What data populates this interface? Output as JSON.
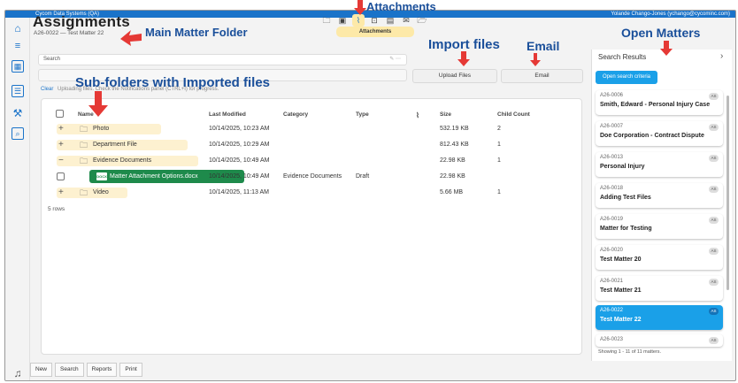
{
  "topbar": {
    "left": "Cycom Data Systems (QA)",
    "right": "Yolande Chango-Jones (ychango@cycominc.com)"
  },
  "header": {
    "title": "Assignments",
    "subtitle": "A26-0022 — Test Matter 22"
  },
  "toolbar": {
    "attachments_tab": "Attachments"
  },
  "search": {
    "placeholder": "Search"
  },
  "actions": {
    "upload": "Upload Files",
    "email": "Email"
  },
  "status": {
    "clear": "Clear",
    "message": "Uploading files. Check the Notifications panel (CTRL+I) for progress."
  },
  "table": {
    "headers": {
      "name": "Name",
      "modified": "Last Modified",
      "category": "Category",
      "type": "Type",
      "size": "Size",
      "children": "Child Count"
    },
    "rows": [
      {
        "name": "Photo",
        "modified": "10/14/2025, 10:23 AM",
        "category": "",
        "type": "",
        "size": "532.19 KB",
        "children": "2"
      },
      {
        "name": "Department File",
        "modified": "10/14/2025, 10:29 AM",
        "category": "",
        "type": "",
        "size": "812.43 KB",
        "children": "1"
      },
      {
        "name": "Evidence Documents",
        "modified": "10/14/2025, 10:49 AM",
        "category": "",
        "type": "",
        "size": "22.98 KB",
        "children": "1"
      },
      {
        "name": "Matter Attachment Options.docx",
        "modified": "10/14/2025, 10:49 AM",
        "category": "Evidence Documents",
        "type": "Draft",
        "size": "22.98 KB",
        "children": ""
      },
      {
        "name": "Video",
        "modified": "10/14/2025, 11:13 AM",
        "category": "",
        "type": "",
        "size": "5.66 MB",
        "children": "1"
      }
    ],
    "row_count": "5 rows",
    "doc_icon_label": "DOCX"
  },
  "bottombar": {
    "new": "New",
    "search": "Search",
    "reports": "Reports",
    "print": "Print"
  },
  "right_panel": {
    "title": "Search Results",
    "open_criteria": "Open search criteria",
    "matters": [
      {
        "id": "A26-0006",
        "name": "Smith, Edward - Personal Injury Case",
        "badge": "AS"
      },
      {
        "id": "A26-0007",
        "name": "Doe Corporation - Contract Dispute",
        "badge": "AS"
      },
      {
        "id": "A26-0013",
        "name": "Personal Injury",
        "badge": "AS"
      },
      {
        "id": "A26-0018",
        "name": "Adding Test Files",
        "badge": "AS"
      },
      {
        "id": "A26-0019",
        "name": "Matter for Testing",
        "badge": "AS"
      },
      {
        "id": "A26-0020",
        "name": "Test Matter 20",
        "badge": "AS"
      },
      {
        "id": "A26-0021",
        "name": "Test Matter 21",
        "badge": "AS"
      },
      {
        "id": "A26-0022",
        "name": "Test Matter 22",
        "badge": "AS"
      },
      {
        "id": "A26-0023",
        "name": "",
        "badge": "AS"
      }
    ],
    "showing": "Showing 1 - 11 of 11 matters."
  },
  "annotations": {
    "attachments": "Attachments",
    "main_folder": "Main Matter Folder",
    "import_files": "Import files",
    "email": "Email",
    "open_matters": "Open Matters",
    "subfolders": "Sub-folders with Imported files"
  },
  "colors": {
    "accent": "#1a73c9",
    "highlight": "#fdf1d0",
    "doc_green": "#1e8a4b",
    "arrow_red": "#e53935",
    "annotation_blue": "#1a4f9a"
  }
}
